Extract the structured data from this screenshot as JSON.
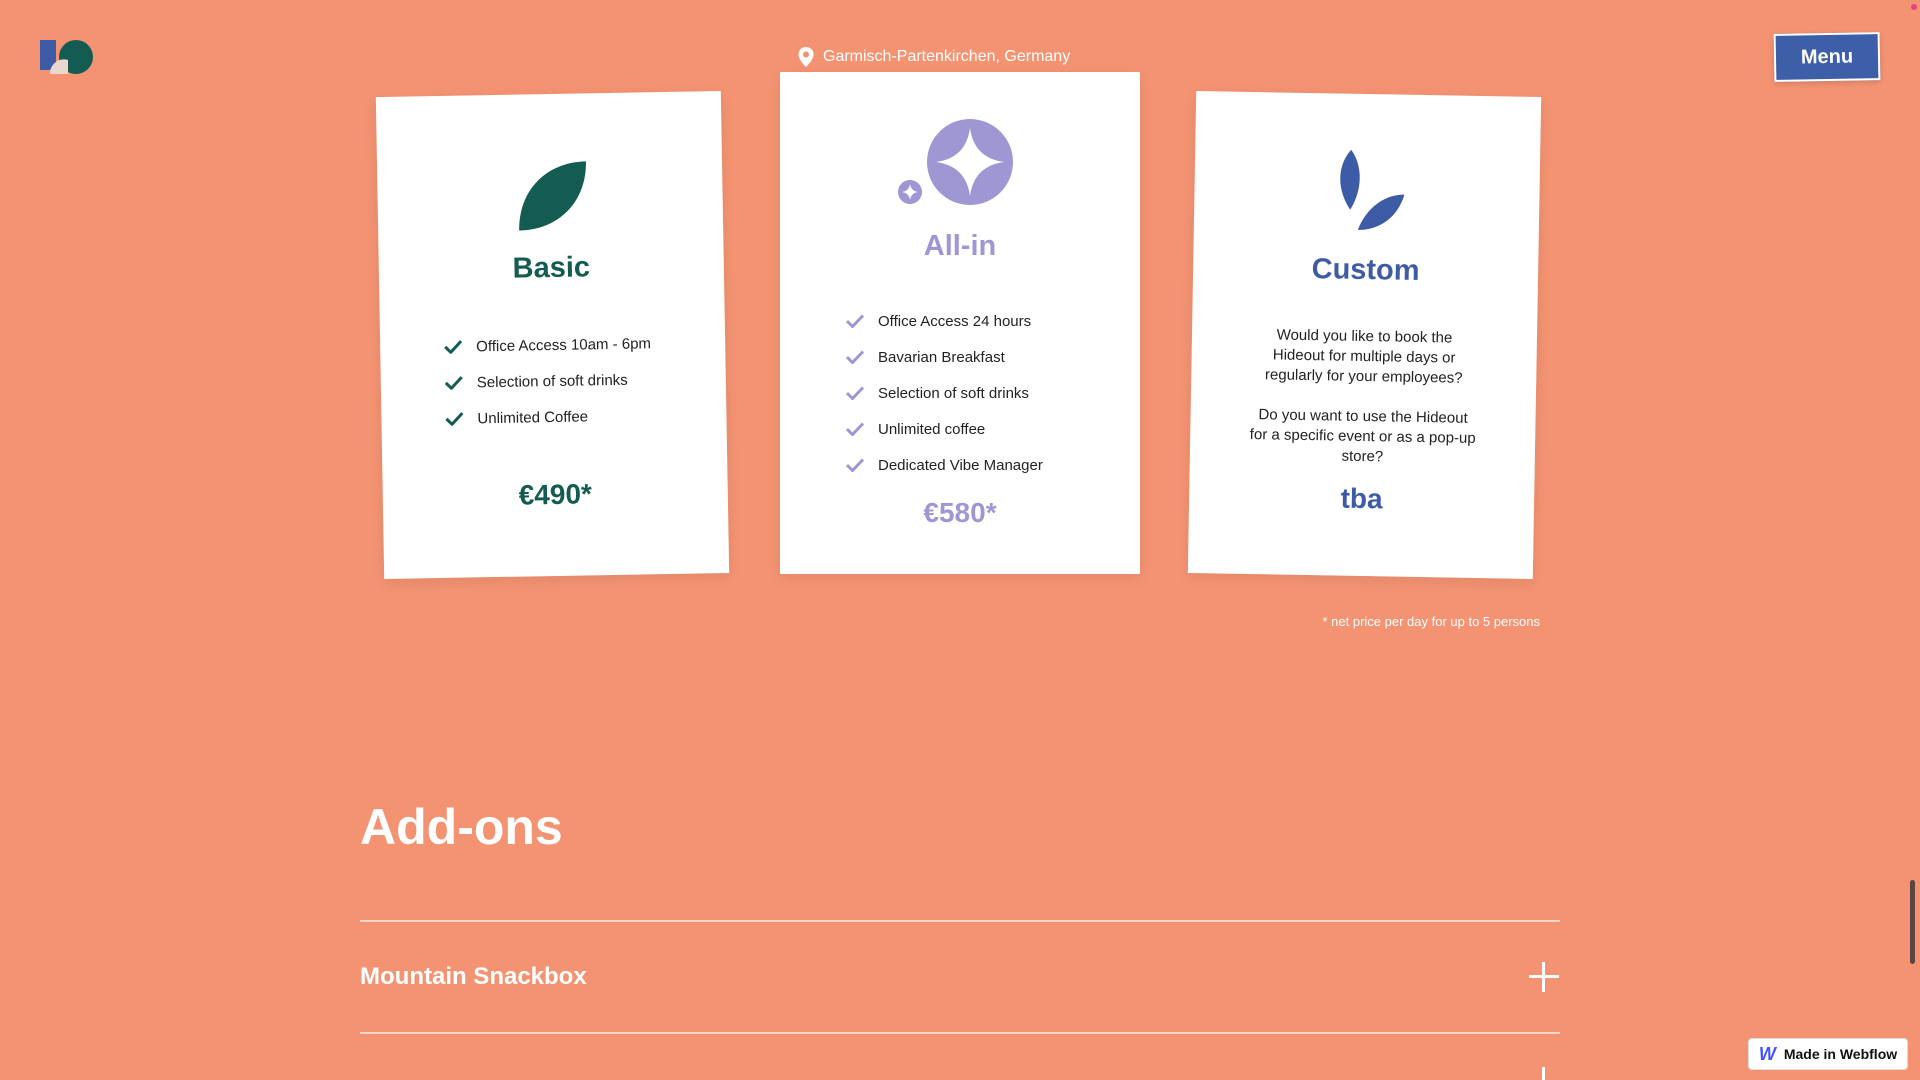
{
  "header": {
    "location": "Garmisch-Partenkirchen, Germany",
    "menu_label": "Menu"
  },
  "colors": {
    "background": "#F39372",
    "basic": "#145C52",
    "allin": "#9E97D4",
    "custom": "#3E5CA6",
    "menu": "#3D5FA8"
  },
  "plans": {
    "basic": {
      "title": "Basic",
      "icon": "leaf-icon",
      "features": [
        "Office Access 10am - 6pm",
        "Selection of soft drinks",
        "Unlimited Coffee"
      ],
      "price": "€490*"
    },
    "allin": {
      "title": "All-in",
      "icon": "sparkle-icon",
      "features": [
        "Office Access 24 hours",
        "Bavarian Breakfast",
        "Selection of soft drinks",
        "Unlimited coffee",
        "Dedicated Vibe Manager"
      ],
      "price": "€580*"
    },
    "custom": {
      "title": "Custom",
      "icon": "double-leaf-icon",
      "text1": "Would you like to book the Hideout for multiple days or regularly for your employees?",
      "text2": "Do you want to use the Hideout for a specific event or as a pop-up store?",
      "price": "tba"
    }
  },
  "footnote": "* net price per day for up to 5 persons",
  "addons": {
    "title": "Add-ons",
    "items": [
      "Mountain Snackbox"
    ]
  },
  "badge": {
    "logo": "W",
    "label": "Made in Webflow"
  }
}
